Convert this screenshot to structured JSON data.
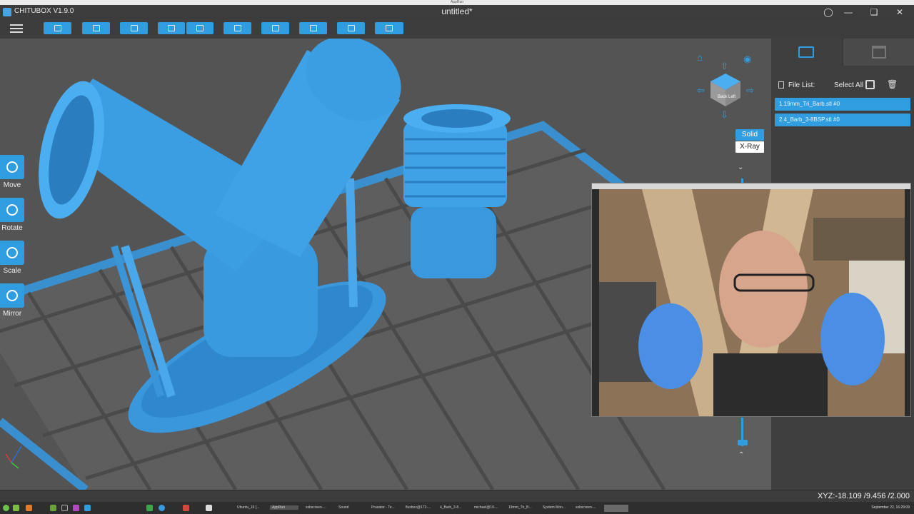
{
  "os": {
    "top_label": "AppRun"
  },
  "window": {
    "app_name": "CHITUBOX V1.9.0",
    "document_title": "untitled*",
    "controls": [
      "user",
      "minimize",
      "maximize",
      "close"
    ]
  },
  "toolbar": {
    "buttons": [
      "open-file",
      "save",
      "export",
      "undo",
      "redo",
      "copy",
      "arrange",
      "hollow",
      "drill",
      "slice"
    ]
  },
  "tools": [
    {
      "label": "Move",
      "icon": "move-icon"
    },
    {
      "label": "Rotate",
      "icon": "rotate-icon"
    },
    {
      "label": "Scale",
      "icon": "scale-icon"
    },
    {
      "label": "Mirror",
      "icon": "mirror-icon"
    }
  ],
  "view": {
    "cube_faces": [
      "Back",
      "Left"
    ],
    "render_modes": [
      "Solid",
      "X-Ray"
    ],
    "active_render_mode": "Solid"
  },
  "right_panel": {
    "file_list_label": "File List:",
    "select_all_label": "Select All",
    "files": [
      "1.19mm_Tri_Barb.stl #0",
      "2.4_Barb_3-8BSP.stl #0"
    ]
  },
  "webcam": {
    "title": ""
  },
  "status": {
    "xyz": "XYZ:-18.109 /9.456 /2.000"
  },
  "taskbar": {
    "items": [
      "Ubuntu_16 [...",
      "AppRun",
      "ssbscreen-...",
      "Sound",
      "Prusator - Te...",
      "fluxbox@172-...",
      "4_Barb_3-8...",
      "michael@10-...",
      "19mm_Tri_B...",
      "System Mon...",
      "ssbscreen-..."
    ],
    "clock": "September 22, 16:29:09"
  },
  "colors": {
    "accent": "#2f9de0",
    "background": "#545454",
    "panel": "#3f3f3f"
  }
}
